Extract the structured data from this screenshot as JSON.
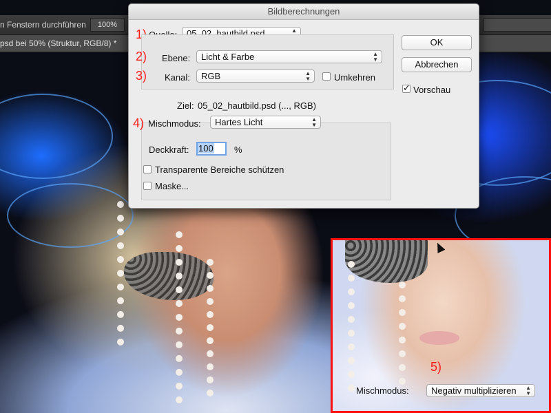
{
  "options_bar": {
    "label": "n Fenstern durchführen",
    "zoom": "100%"
  },
  "document_tab": {
    "title": "psd bei 50% (Struktur, RGB/8) *"
  },
  "dialog": {
    "title": "Bildberechnungen",
    "annotations": [
      "1)",
      "2)",
      "3)",
      "4)"
    ],
    "source": {
      "label": "Quelle:",
      "value": "05_02_hautbild.psd"
    },
    "layer": {
      "label": "Ebene:",
      "value": "Licht & Farbe"
    },
    "channel": {
      "label": "Kanal:",
      "value": "RGB"
    },
    "invert": {
      "label": "Umkehren",
      "checked": false
    },
    "target": {
      "label": "Ziel:",
      "value": "05_02_hautbild.psd (..., RGB)"
    },
    "blend_mode": {
      "label": "Mischmodus:",
      "value": "Hartes Licht"
    },
    "opacity": {
      "label": "Deckkraft:",
      "value": "100",
      "unit": "%"
    },
    "preserve_transparency": {
      "label": "Transparente Bereiche schützen",
      "checked": false
    },
    "mask": {
      "label": "Maske...",
      "checked": false
    },
    "ok_label": "OK",
    "cancel_label": "Abbrechen",
    "preview": {
      "label": "Vorschau",
      "checked": true
    }
  },
  "inset": {
    "annotation": "5)",
    "blend_mode_label": "Mischmodus:",
    "blend_mode_value": "Negativ multiplizieren"
  },
  "colors": {
    "annotation_red": "#ff1a1a",
    "dialog_bg": "#ececec",
    "focus_blue": "#6ea3e6"
  },
  "icons": {
    "dropdown": "chevron-updown-icon",
    "cursor": "mouse-pointer-icon",
    "checkbox": "checkmark-icon"
  }
}
